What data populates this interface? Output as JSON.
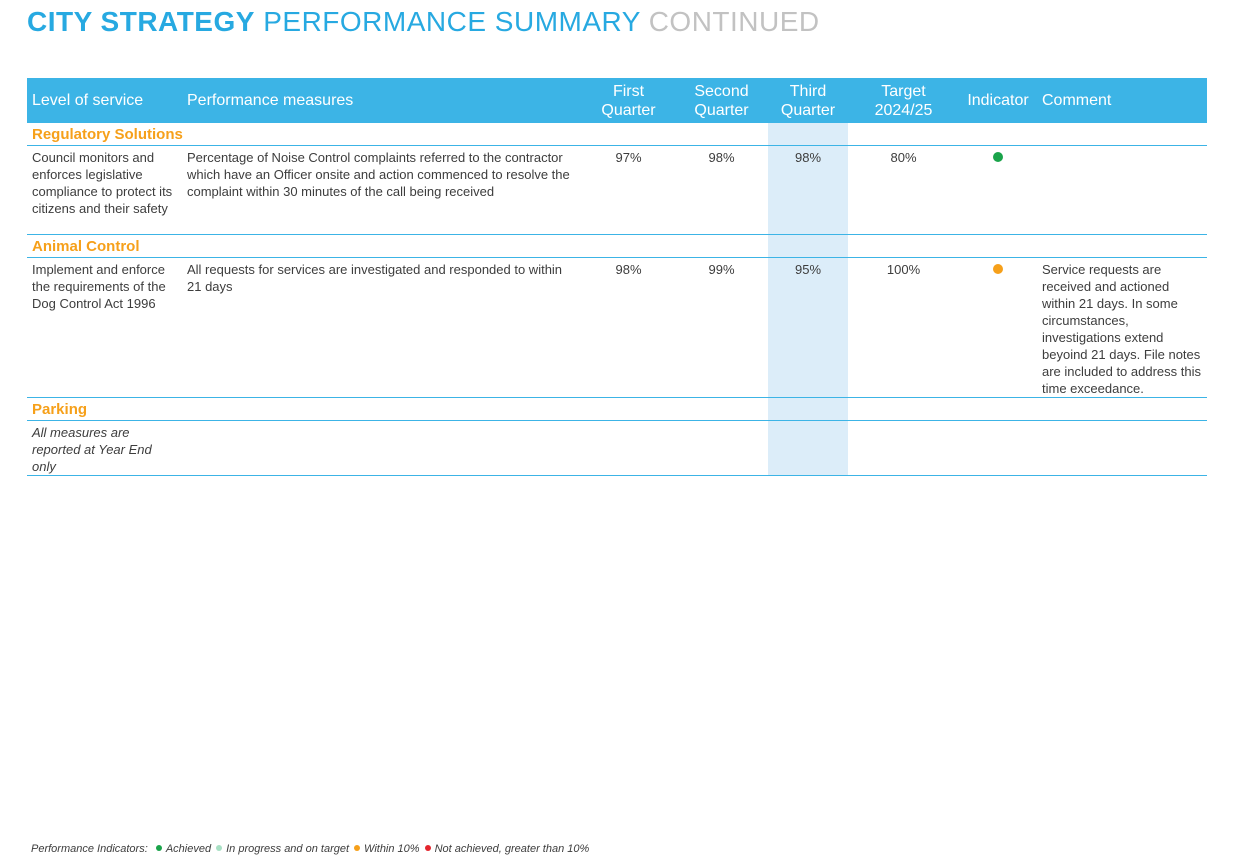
{
  "title": {
    "part1": "CITY STRATEGY",
    "part2": "PERFORMANCE SUMMARY",
    "part3": "CONTINUED"
  },
  "colors": {
    "header_bg": "#3cb4e6",
    "section_text": "#f6a01a",
    "third_quarter_bg": "#dcedf9",
    "achieved": "#1aa34a",
    "in_progress": "#a8e0c4",
    "within_10": "#f6a01a",
    "not_achieved": "#e4252d"
  },
  "columns": {
    "level": "Level of service",
    "measures": "Performance measures",
    "q1": "First Quarter",
    "q2": "Second Quarter",
    "q3": "Third Quarter",
    "target": "Target 2024/25",
    "indicator": "Indicator",
    "comment": "Comment"
  },
  "sections": [
    {
      "name": "Regulatory Solutions",
      "rows": [
        {
          "level": "Council monitors and enforces legislative compliance to protect its citizens and their safety",
          "measure": "Percentage of Noise Control complaints referred to the contractor which have an Officer onsite and action commenced to resolve the complaint within 30 minutes of the call being received",
          "q1": "97%",
          "q2": "98%",
          "q3": "98%",
          "target": "80%",
          "indicator": "achieved",
          "comment": ""
        }
      ]
    },
    {
      "name": "Animal Control",
      "rows": [
        {
          "level": "Implement and enforce the requirements of the Dog Control Act 1996",
          "measure": "All requests for services are investigated and responded to within 21 days",
          "q1": "98%",
          "q2": "99%",
          "q3": "95%",
          "target": "100%",
          "indicator": "within_10",
          "comment": "Service requests are received and actioned within 21 days. In some circumstances, investigations extend beyoind 21 days. File notes are included to address this time exceedance."
        }
      ]
    },
    {
      "name": "Parking",
      "rows": [
        {
          "level": "All measures are reported at Year End only",
          "measure": "",
          "q1": "",
          "q2": "",
          "q3": "",
          "target": "",
          "indicator": "",
          "comment": ""
        }
      ]
    }
  ],
  "legend": {
    "label": "Performance Indicators:",
    "items": [
      {
        "key": "achieved",
        "text": "Achieved"
      },
      {
        "key": "in_progress",
        "text": "In progress and on target"
      },
      {
        "key": "within_10",
        "text": "Within 10%"
      },
      {
        "key": "not_achieved",
        "text": "Not achieved, greater than 10%"
      }
    ]
  }
}
